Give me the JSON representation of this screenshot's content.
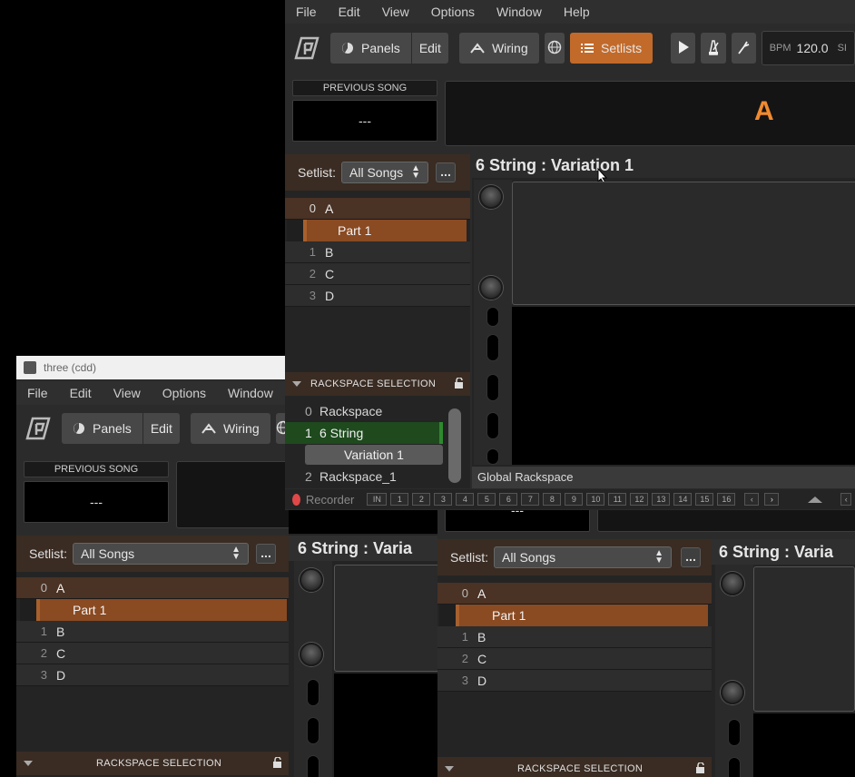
{
  "menu": [
    "File",
    "Edit",
    "View",
    "Options",
    "Window",
    "Help"
  ],
  "toolbar": {
    "panels": "Panels",
    "edit": "Edit",
    "wiring": "Wiring",
    "setlists": "Setlists",
    "bpm_label": "BPM",
    "bpm_value": "120.0",
    "si": "SI"
  },
  "prev_song": {
    "label": "PREVIOUS SONG",
    "value": "---"
  },
  "current_song_big": "A",
  "setlist": {
    "label": "Setlist:",
    "selected": "All Songs",
    "more": "..."
  },
  "songs": [
    {
      "num": "0",
      "name": "A"
    },
    {
      "num": "1",
      "name": "B"
    },
    {
      "num": "2",
      "name": "C"
    },
    {
      "num": "3",
      "name": "D"
    }
  ],
  "part": "Part 1",
  "rackspace_header": "RACKSPACE SELECTION",
  "rackspaces": [
    {
      "num": "0",
      "name": "Rackspace"
    },
    {
      "num": "1",
      "name": "6 String"
    },
    {
      "num": "2",
      "name": "Rackspace_1"
    }
  ],
  "variation": "Variation 1",
  "rack_title": "6 String : Variation 1",
  "rack_title_short": "6 String : Varia",
  "global_rackspace": "Global Rackspace",
  "recorder": "Recorder",
  "in_label": "IN",
  "channels": [
    "1",
    "2",
    "3",
    "4",
    "5",
    "6",
    "7",
    "8",
    "9",
    "10",
    "11",
    "12",
    "13",
    "14",
    "15",
    "16"
  ],
  "win2_title": "three (cdd)",
  "win3_prev_value": "---",
  "colors": {
    "accent": "#c26a2a",
    "part_bg": "#8a4a22",
    "selected_rack": "#1e4a1e",
    "big_letter": "#f08a30"
  }
}
